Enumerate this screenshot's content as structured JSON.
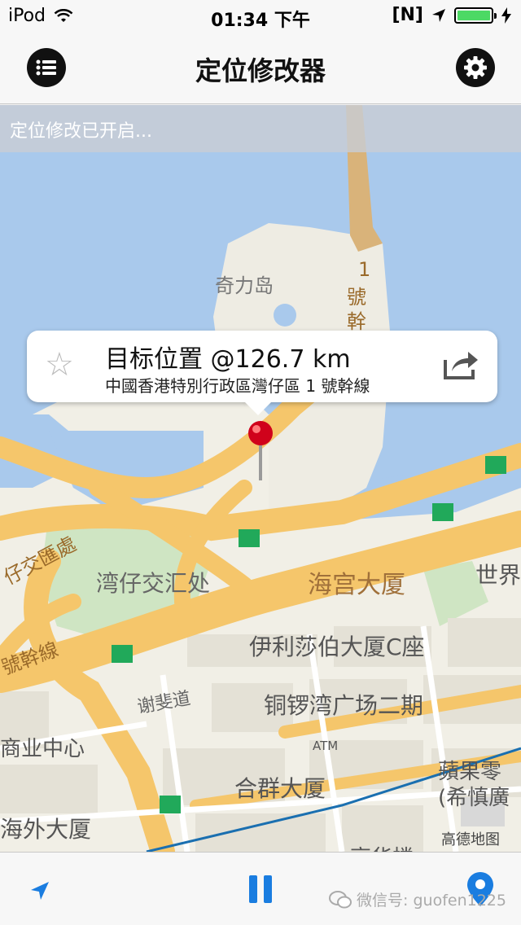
{
  "status_bar": {
    "carrier": "iPod",
    "time": "01:34 下午",
    "indicator": "[N]",
    "battery_level": 1.0,
    "icons": [
      "wifi-icon",
      "location-arrow-icon",
      "battery-icon",
      "charging-bolt-icon"
    ]
  },
  "nav": {
    "title": "定位修改器",
    "left_icon": "list-icon",
    "right_icon": "gear-icon"
  },
  "status_strip": {
    "text": "定位修改已开启..."
  },
  "callout": {
    "title": "目标位置 @126.7 km",
    "subtitle": "中國香港特別行政區灣仔區 1 號幹線",
    "star_icon": "star-icon",
    "share_icon": "share-icon"
  },
  "map_labels": {
    "island": "奇力岛",
    "road1_a": "1",
    "road1_b": "號",
    "road1_c": "幹",
    "interchange": "湾仔交汇处",
    "haigong": "海宫大厦",
    "shijie": "世界",
    "elizabeth": "伊利莎伯大厦C座",
    "xiefei": "谢斐道",
    "causeway": "铜锣湾广场二期",
    "business": "商业中心",
    "atm": "ATM",
    "hequn": "合群大厦",
    "apple_a": "蘋果零",
    "apple_b": "(希慎廣",
    "overseas": "海外大厦",
    "gaode": "高德地图",
    "road_left_a": "仔交匯處",
    "road_left_b": "號幹線",
    "bottom_cut": "高华楼"
  },
  "tabbar": {
    "locate_icon": "location-arrow-icon",
    "pause_icon": "pause-icon",
    "pin_icon": "map-pin-icon",
    "watermark": "微信号: guofen1225",
    "wechat_icon": "wechat-icon"
  },
  "colors": {
    "water": "#a9c9ec",
    "land": "#f1efe6",
    "road_major": "#f5c66b",
    "park": "#cfe5c3",
    "pin": "#d0021b",
    "accent_blue": "#1a7de0"
  }
}
